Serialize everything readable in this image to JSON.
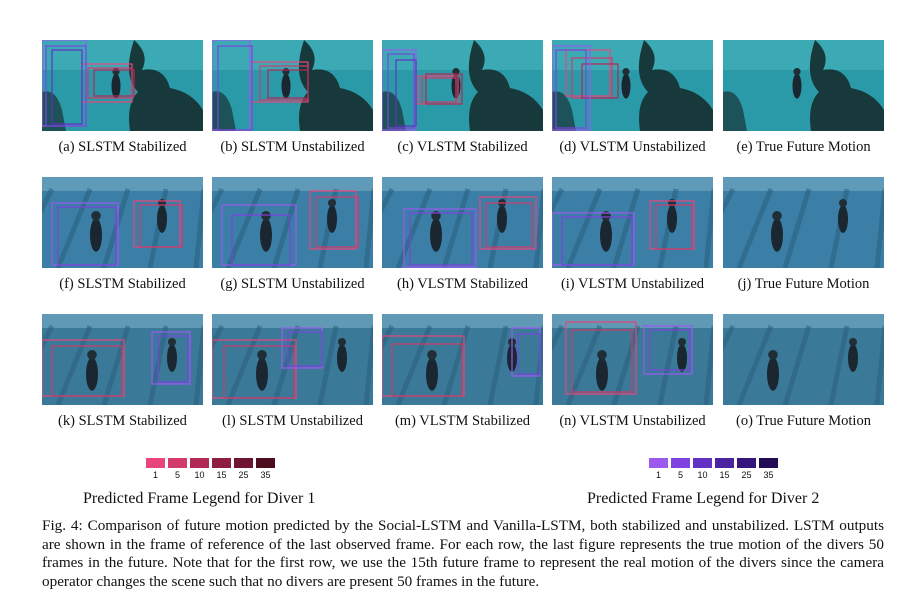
{
  "figure": {
    "rows": [
      [
        {
          "caption": "(a) SLSTM Stabilized",
          "scene": "reef"
        },
        {
          "caption": "(b) SLSTM Unstabilized",
          "scene": "reef"
        },
        {
          "caption": "(c) VLSTM Stabilized",
          "scene": "reef"
        },
        {
          "caption": "(d) VLSTM Unstabilized",
          "scene": "reef"
        },
        {
          "caption": "(e) True Future Motion",
          "scene": "reef"
        }
      ],
      [
        {
          "caption": "(f) SLSTM Stabilized",
          "scene": "pool"
        },
        {
          "caption": "(g) SLSTM Unstabilized",
          "scene": "pool"
        },
        {
          "caption": "(h) VLSTM Stabilized",
          "scene": "pool"
        },
        {
          "caption": "(i) VLSTM Unstabilized",
          "scene": "pool"
        },
        {
          "caption": "(j) True Future Motion",
          "scene": "pool"
        }
      ],
      [
        {
          "caption": "(k) SLSTM Stabilized",
          "scene": "pool2"
        },
        {
          "caption": "(l) SLSTM Unstabilized",
          "scene": "pool2"
        },
        {
          "caption": "(m) VLSTM Stabilized",
          "scene": "pool2"
        },
        {
          "caption": "(n) VLSTM Unstabilized",
          "scene": "pool2"
        },
        {
          "caption": "(o) True Future Motion",
          "scene": "pool2"
        }
      ]
    ],
    "legends": [
      {
        "label": "Predicted Frame Legend for Diver 1",
        "ticks": [
          "1",
          "5",
          "10",
          "15",
          "25",
          "35"
        ],
        "colors": [
          "#e8457a",
          "#d23a6a",
          "#b02a55",
          "#8e1d40",
          "#6e1430",
          "#4e0c1f"
        ]
      },
      {
        "label": "Predicted Frame Legend for Diver 2",
        "ticks": [
          "1",
          "5",
          "10",
          "15",
          "25",
          "35"
        ],
        "colors": [
          "#9b59f0",
          "#7e42e0",
          "#6330c4",
          "#4b22a0",
          "#36167c",
          "#230c56"
        ]
      }
    ],
    "caption": "Fig. 4: Comparison of future motion predicted by the Social-LSTM and Vanilla-LSTM, both stabilized and unstabilized. LSTM outputs are shown in the frame of reference of the last observed frame. For each row, the last figure represents the true motion of the divers 50 frames in the future. Note that for the first row, we use the 15th future frame to represent the real motion of the divers since the camera operator changes the scene such that no divers are present 50 frames in the future."
  }
}
